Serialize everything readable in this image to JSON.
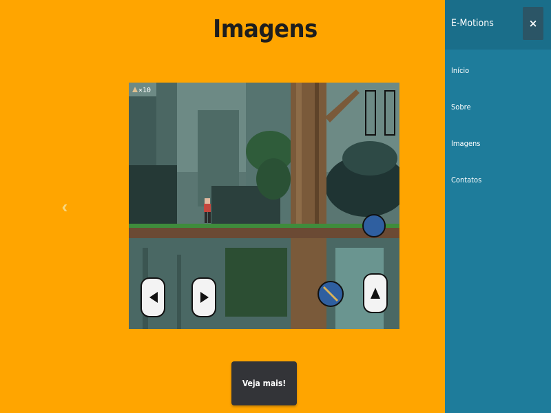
{
  "main": {
    "title": "Imagens",
    "carousel": {
      "prev_icon": "chevron-left-icon",
      "prev_glyph": "‹"
    },
    "slide": {
      "description_icon": "game-screenshot",
      "hud_counter": "×10"
    },
    "more_button_label": "Veja mais!"
  },
  "sidebar": {
    "brand": "E-Motions",
    "close_label": "×",
    "items": [
      {
        "label": "Início"
      },
      {
        "label": "Sobre"
      },
      {
        "label": "Imagens"
      },
      {
        "label": "Contatos"
      }
    ]
  },
  "colors": {
    "background": "#ffa500",
    "sidebar": "#1e7c9b",
    "sidebar_header": "#1a6e8a",
    "button_dark": "#333438",
    "title_text": "#1e1e1e"
  }
}
